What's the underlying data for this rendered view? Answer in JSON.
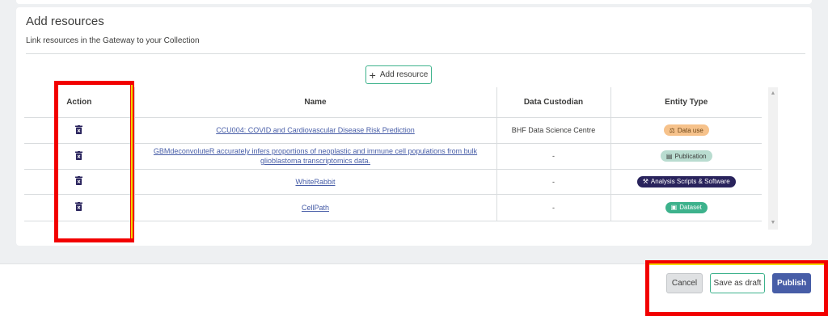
{
  "section": {
    "title": "Add resources",
    "subtitle": "Link resources in the Gateway to your Collection",
    "add_button_label": "Add resource"
  },
  "table": {
    "headers": {
      "action": "Action",
      "name": "Name",
      "custodian": "Data Custodian",
      "entity_type": "Entity Type"
    },
    "rows": [
      {
        "name": "CCU004: COVID and Cardiovascular Disease Risk Prediction",
        "custodian": "BHF Data Science Centre",
        "entity_type": "Data use",
        "badge_color": "#f6c28b",
        "icon": "data-use-icon"
      },
      {
        "name": "GBMdeconvoluteR accurately infers proportions of neoplastic and immune cell populations from bulk glioblastoma transcriptomics data.",
        "custodian": "-",
        "entity_type": "Publication",
        "badge_color": "#b9dcd0",
        "icon": "publication-icon"
      },
      {
        "name": "WhiteRabbit",
        "custodian": "-",
        "entity_type": "Analysis Scripts & Software",
        "badge_color": "#29235c",
        "icon": "tools-icon"
      },
      {
        "name": "CellPath",
        "custodian": "-",
        "entity_type": "Dataset",
        "badge_color": "#3db28c",
        "icon": "dataset-icon"
      }
    ]
  },
  "footer": {
    "cancel_label": "Cancel",
    "draft_label": "Save as draft",
    "publish_label": "Publish"
  },
  "colors": {
    "highlight": "#f20000",
    "accent_green": "#3db28c",
    "link_blue": "#475da7"
  }
}
